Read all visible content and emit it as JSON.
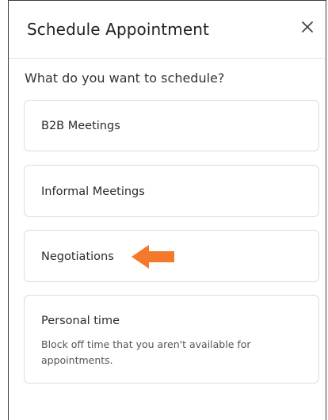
{
  "dialog": {
    "title": "Schedule Appointment",
    "close_icon": "close-icon",
    "question": "What do you want to schedule?"
  },
  "options": [
    {
      "label": "B2B Meetings"
    },
    {
      "label": "Informal Meetings"
    },
    {
      "label": "Negotiations"
    },
    {
      "label": "Personal time",
      "description": "Block off time that you aren't available for appointments."
    }
  ],
  "annotation": {
    "icon": "arrow-left-icon",
    "color": "#f47a2a"
  }
}
